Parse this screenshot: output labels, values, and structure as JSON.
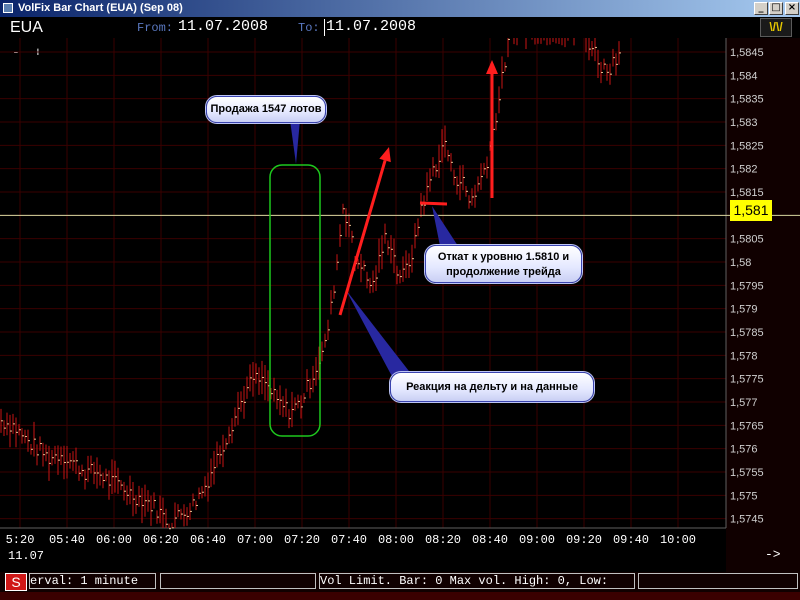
{
  "window": {
    "title": "VolFix Bar Chart (EUA) (Sep 08)",
    "controls": [
      "_",
      "□",
      "×"
    ]
  },
  "header": {
    "symbol": "EUA",
    "from_label": "From:",
    "from_value": "11.07.2008",
    "to_label": "To:",
    "to_value": "11.07.2008",
    "mode_button": "\\/\\/"
  },
  "zoom": {
    "minus": "-",
    "plus": "+"
  },
  "current_price": "1,581",
  "annotations": {
    "sale": "Продажа 1547 лотов",
    "pullback_line1": "Откат к уровню 1.5810 и",
    "pullback_line2": "продолжение трейда",
    "reaction": "Реакция на дельту и на данные"
  },
  "footer": {
    "date": "11.07",
    "nav_arrow": "->"
  },
  "status": {
    "button": "S",
    "interval": "erval: 1 minute",
    "vol_info": "Vol Limit. Bar: 0 Max vol. High: 0, Low:"
  },
  "colors": {
    "background": "#000000",
    "grid": "#3a0000",
    "bars": "#c81414",
    "price_line": "#d8d8a0",
    "price_box": "#ffff00",
    "arrows": "#ff1e1e",
    "highlight_box": "#1ec81e",
    "callout_pointer": "#2828a0"
  },
  "chart_data": {
    "type": "bar",
    "title": "",
    "x_ticks": [
      "5:20",
      "05:40",
      "06:00",
      "06:20",
      "06:40",
      "07:00",
      "07:20",
      "07:40",
      "08:00",
      "08:20",
      "08:40",
      "09:00",
      "09:20",
      "09:40",
      "10:00"
    ],
    "y_ticks": [
      "1,5845",
      "1,584",
      "1,5835",
      "1,583",
      "1,5825",
      "1,582",
      "1,5815",
      "1,581",
      "1,5805",
      "1,58",
      "1,5795",
      "1,579",
      "1,5785",
      "1,578",
      "1,5775",
      "1,577",
      "1,5765",
      "1,576",
      "1,5755",
      "1,575",
      "1,5745"
    ],
    "ylim": [
      1.5743,
      1.5848
    ],
    "grid": true,
    "horizontal_line": 1.581,
    "anchors": [
      [
        0,
        1.5766
      ],
      [
        4,
        1.5765
      ],
      [
        8,
        1.5762
      ],
      [
        12,
        1.576
      ],
      [
        16,
        1.5758
      ],
      [
        20,
        1.5759
      ],
      [
        24,
        1.5757
      ],
      [
        28,
        1.5755
      ],
      [
        32,
        1.5755
      ],
      [
        36,
        1.5753
      ],
      [
        40,
        1.5752
      ],
      [
        44,
        1.575
      ],
      [
        48,
        1.5749
      ],
      [
        52,
        1.5747
      ],
      [
        56,
        1.5744
      ],
      [
        60,
        1.5746
      ],
      [
        64,
        1.5748
      ],
      [
        68,
        1.5752
      ],
      [
        72,
        1.5758
      ],
      [
        76,
        1.5764
      ],
      [
        80,
        1.577
      ],
      [
        84,
        1.5775
      ],
      [
        88,
        1.5774
      ],
      [
        92,
        1.577
      ],
      [
        96,
        1.5768
      ],
      [
        100,
        1.577
      ],
      [
        104,
        1.5776
      ],
      [
        108,
        1.5782
      ],
      [
        110,
        1.579
      ],
      [
        112,
        1.58
      ],
      [
        114,
        1.5812
      ],
      [
        116,
        1.5808
      ],
      [
        118,
        1.58
      ],
      [
        120,
        1.58
      ],
      [
        122,
        1.5796
      ],
      [
        124,
        1.5795
      ],
      [
        126,
        1.58
      ],
      [
        128,
        1.5805
      ],
      [
        130,
        1.5804
      ],
      [
        132,
        1.5798
      ],
      [
        134,
        1.5797
      ],
      [
        136,
        1.58
      ],
      [
        138,
        1.5804
      ],
      [
        140,
        1.5812
      ],
      [
        142,
        1.5815
      ],
      [
        144,
        1.582
      ],
      [
        146,
        1.5822
      ],
      [
        148,
        1.5826
      ],
      [
        150,
        1.582
      ],
      [
        152,
        1.5818
      ],
      [
        154,
        1.5817
      ],
      [
        156,
        1.5813
      ],
      [
        158,
        1.5815
      ],
      [
        160,
        1.5818
      ],
      [
        162,
        1.5822
      ],
      [
        164,
        1.5828
      ],
      [
        166,
        1.5835
      ],
      [
        168,
        1.5843
      ],
      [
        170,
        1.585
      ],
      [
        172,
        1.585
      ],
      [
        174,
        1.585
      ],
      [
        176,
        1.585
      ],
      [
        178,
        1.585
      ],
      [
        180,
        1.585
      ],
      [
        182,
        1.585
      ],
      [
        184,
        1.585
      ],
      [
        186,
        1.585
      ],
      [
        188,
        1.585
      ],
      [
        190,
        1.585
      ],
      [
        192,
        1.585
      ],
      [
        194,
        1.585
      ],
      [
        196,
        1.5847
      ],
      [
        198,
        1.5845
      ],
      [
        200,
        1.5842
      ],
      [
        202,
        1.5841
      ],
      [
        204,
        1.5843
      ],
      [
        206,
        1.5845
      ]
    ]
  }
}
